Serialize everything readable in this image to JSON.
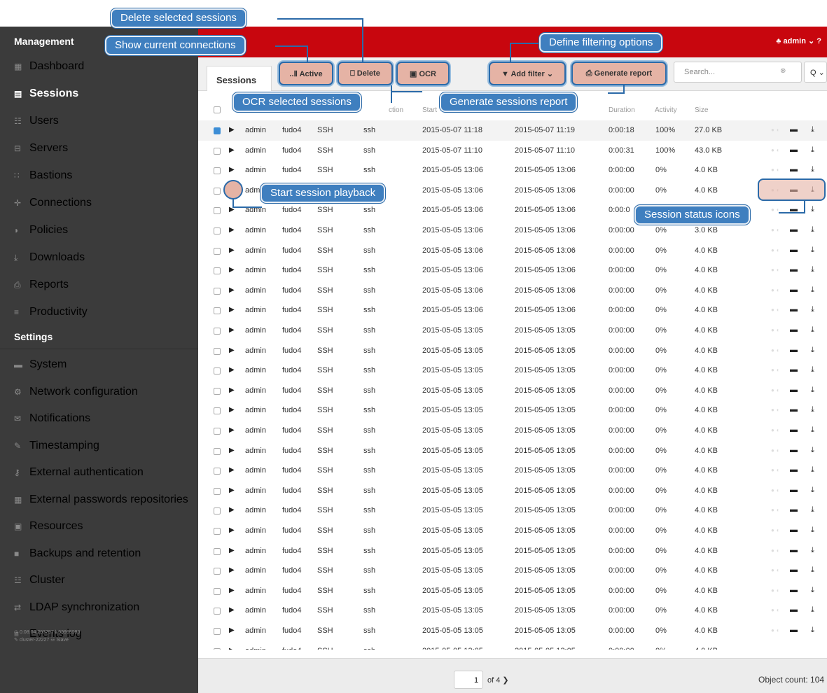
{
  "header": {
    "brand": "Management",
    "user_label": "♣ admin ⌄",
    "help": "?"
  },
  "sidebar": {
    "management_items": [
      {
        "icon": "dashboard-icon",
        "glyph": "▦",
        "label": "Dashboard"
      },
      {
        "icon": "sessions-icon",
        "glyph": "▤",
        "label": "Sessions"
      },
      {
        "icon": "users-icon",
        "glyph": "☷",
        "label": "Users"
      },
      {
        "icon": "servers-icon",
        "glyph": "⊟",
        "label": "Servers"
      },
      {
        "icon": "bastions-icon",
        "glyph": "∷",
        "label": "Bastions"
      },
      {
        "icon": "connections-icon",
        "glyph": "✛",
        "label": "Connections"
      },
      {
        "icon": "policies-icon",
        "glyph": "◗",
        "label": "Policies"
      },
      {
        "icon": "downloads-icon",
        "glyph": "⤓",
        "label": "Downloads"
      },
      {
        "icon": "reports-icon",
        "glyph": "⎙",
        "label": "Reports"
      },
      {
        "icon": "productivity-icon",
        "glyph": "≡",
        "label": "Productivity"
      }
    ],
    "settings_title": "Settings",
    "settings_items": [
      {
        "icon": "system-icon",
        "glyph": "▬",
        "label": "System"
      },
      {
        "icon": "network-icon",
        "glyph": "⚙",
        "label": "Network configuration"
      },
      {
        "icon": "notifications-icon",
        "glyph": "✉",
        "label": "Notifications"
      },
      {
        "icon": "timestamping-icon",
        "glyph": "✎",
        "label": "Timestamping"
      },
      {
        "icon": "external-auth-icon",
        "glyph": "⚷",
        "label": "External authentication"
      },
      {
        "icon": "passwords-repo-icon",
        "glyph": "▦",
        "label": "External passwords repositories"
      },
      {
        "icon": "resources-icon",
        "glyph": "▣",
        "label": "Resources"
      },
      {
        "icon": "backups-icon",
        "glyph": "■",
        "label": "Backups and retention"
      },
      {
        "icon": "cluster-icon",
        "glyph": "☳",
        "label": "Cluster"
      },
      {
        "icon": "ldap-icon",
        "glyph": "⇄",
        "label": "LDAP synchronization"
      },
      {
        "icon": "events-icon",
        "glyph": "≡",
        "label": "Events log"
      }
    ],
    "footer_line1": "◷ 0:08:04.293297 ℹ 99999999",
    "footer_line2": "✎ cluster-22227  ☳ Slave"
  },
  "toolbar": {
    "tab": "Sessions",
    "active": "..Ⅱ Active",
    "delete": "⎕ Delete",
    "ocr": "▣ OCR",
    "add_filter": "▼ Add filter ⌄",
    "generate_report": "⎙ Generate report",
    "search_placeholder": "Search...",
    "search_clear": "⊗",
    "search_btn": "Q ⌄"
  },
  "table": {
    "headers": [
      "Start",
      "End",
      "Duration",
      "Activity",
      "Size"
    ],
    "header_partial": "ction",
    "rows": [
      {
        "sel": true,
        "user": "admin",
        "server": "fudo4",
        "proto": "SSH",
        "conn": "ssh",
        "start": "2015-05-07 11:18",
        "end": "2015-05-07 11:19",
        "dur": "0:00:18",
        "act": "100%",
        "size": "27.0 KB"
      },
      {
        "sel": false,
        "user": "admin",
        "server": "fudo4",
        "proto": "SSH",
        "conn": "ssh",
        "start": "2015-05-07 11:10",
        "end": "2015-05-07 11:10",
        "dur": "0:00:31",
        "act": "100%",
        "size": "43.0 KB"
      },
      {
        "sel": false,
        "user": "admin",
        "server": "fudo4",
        "proto": "SSH",
        "conn": "ssh",
        "start": "2015-05-05 13:06",
        "end": "2015-05-05 13:06",
        "dur": "0:00:00",
        "act": "0%",
        "size": "4.0 KB"
      },
      {
        "sel": false,
        "user": "adm",
        "server": "",
        "proto": "",
        "conn": "",
        "start": "2015-05-05 13:06",
        "end": "2015-05-05 13:06",
        "dur": "0:00:00",
        "act": "0%",
        "size": "4.0 KB"
      },
      {
        "sel": false,
        "user": "admin",
        "server": "fudo4",
        "proto": "SSH",
        "conn": "ssh",
        "start": "2015-05-05 13:06",
        "end": "2015-05-05 13:06",
        "dur": "0:00:0",
        "act": "",
        "size": ""
      },
      {
        "sel": false,
        "user": "admin",
        "server": "fudo4",
        "proto": "SSH",
        "conn": "ssh",
        "start": "2015-05-05 13:06",
        "end": "2015-05-05 13:06",
        "dur": "0:00:00",
        "act": "0%",
        "size": "3.0 KB"
      },
      {
        "sel": false,
        "user": "admin",
        "server": "fudo4",
        "proto": "SSH",
        "conn": "ssh",
        "start": "2015-05-05 13:06",
        "end": "2015-05-05 13:06",
        "dur": "0:00:00",
        "act": "0%",
        "size": "4.0 KB"
      },
      {
        "sel": false,
        "user": "admin",
        "server": "fudo4",
        "proto": "SSH",
        "conn": "ssh",
        "start": "2015-05-05 13:06",
        "end": "2015-05-05 13:06",
        "dur": "0:00:00",
        "act": "0%",
        "size": "4.0 KB"
      },
      {
        "sel": false,
        "user": "admin",
        "server": "fudo4",
        "proto": "SSH",
        "conn": "ssh",
        "start": "2015-05-05 13:06",
        "end": "2015-05-05 13:06",
        "dur": "0:00:00",
        "act": "0%",
        "size": "4.0 KB"
      },
      {
        "sel": false,
        "user": "admin",
        "server": "fudo4",
        "proto": "SSH",
        "conn": "ssh",
        "start": "2015-05-05 13:06",
        "end": "2015-05-05 13:06",
        "dur": "0:00:00",
        "act": "0%",
        "size": "4.0 KB"
      },
      {
        "sel": false,
        "user": "admin",
        "server": "fudo4",
        "proto": "SSH",
        "conn": "ssh",
        "start": "2015-05-05 13:05",
        "end": "2015-05-05 13:05",
        "dur": "0:00:00",
        "act": "0%",
        "size": "4.0 KB"
      },
      {
        "sel": false,
        "user": "admin",
        "server": "fudo4",
        "proto": "SSH",
        "conn": "ssh",
        "start": "2015-05-05 13:05",
        "end": "2015-05-05 13:05",
        "dur": "0:00:00",
        "act": "0%",
        "size": "4.0 KB"
      },
      {
        "sel": false,
        "user": "admin",
        "server": "fudo4",
        "proto": "SSH",
        "conn": "ssh",
        "start": "2015-05-05 13:05",
        "end": "2015-05-05 13:05",
        "dur": "0:00:00",
        "act": "0%",
        "size": "4.0 KB"
      },
      {
        "sel": false,
        "user": "admin",
        "server": "fudo4",
        "proto": "SSH",
        "conn": "ssh",
        "start": "2015-05-05 13:05",
        "end": "2015-05-05 13:05",
        "dur": "0:00:00",
        "act": "0%",
        "size": "4.0 KB"
      },
      {
        "sel": false,
        "user": "admin",
        "server": "fudo4",
        "proto": "SSH",
        "conn": "ssh",
        "start": "2015-05-05 13:05",
        "end": "2015-05-05 13:05",
        "dur": "0:00:00",
        "act": "0%",
        "size": "4.0 KB"
      },
      {
        "sel": false,
        "user": "admin",
        "server": "fudo4",
        "proto": "SSH",
        "conn": "ssh",
        "start": "2015-05-05 13:05",
        "end": "2015-05-05 13:05",
        "dur": "0:00:00",
        "act": "0%",
        "size": "4.0 KB"
      },
      {
        "sel": false,
        "user": "admin",
        "server": "fudo4",
        "proto": "SSH",
        "conn": "ssh",
        "start": "2015-05-05 13:05",
        "end": "2015-05-05 13:05",
        "dur": "0:00:00",
        "act": "0%",
        "size": "4.0 KB"
      },
      {
        "sel": false,
        "user": "admin",
        "server": "fudo4",
        "proto": "SSH",
        "conn": "ssh",
        "start": "2015-05-05 13:05",
        "end": "2015-05-05 13:05",
        "dur": "0:00:00",
        "act": "0%",
        "size": "4.0 KB"
      },
      {
        "sel": false,
        "user": "admin",
        "server": "fudo4",
        "proto": "SSH",
        "conn": "ssh",
        "start": "2015-05-05 13:05",
        "end": "2015-05-05 13:05",
        "dur": "0:00:00",
        "act": "0%",
        "size": "4.0 KB"
      },
      {
        "sel": false,
        "user": "admin",
        "server": "fudo4",
        "proto": "SSH",
        "conn": "ssh",
        "start": "2015-05-05 13:05",
        "end": "2015-05-05 13:05",
        "dur": "0:00:00",
        "act": "0%",
        "size": "4.0 KB"
      },
      {
        "sel": false,
        "user": "admin",
        "server": "fudo4",
        "proto": "SSH",
        "conn": "ssh",
        "start": "2015-05-05 13:05",
        "end": "2015-05-05 13:05",
        "dur": "0:00:00",
        "act": "0%",
        "size": "4.0 KB"
      },
      {
        "sel": false,
        "user": "admin",
        "server": "fudo4",
        "proto": "SSH",
        "conn": "ssh",
        "start": "2015-05-05 13:05",
        "end": "2015-05-05 13:05",
        "dur": "0:00:00",
        "act": "0%",
        "size": "4.0 KB"
      },
      {
        "sel": false,
        "user": "admin",
        "server": "fudo4",
        "proto": "SSH",
        "conn": "ssh",
        "start": "2015-05-05 13:05",
        "end": "2015-05-05 13:05",
        "dur": "0:00:00",
        "act": "0%",
        "size": "4.0 KB"
      },
      {
        "sel": false,
        "user": "admin",
        "server": "fudo4",
        "proto": "SSH",
        "conn": "ssh",
        "start": "2015-05-05 13:05",
        "end": "2015-05-05 13:05",
        "dur": "0:00:00",
        "act": "0%",
        "size": "4.0 KB"
      },
      {
        "sel": false,
        "user": "admin",
        "server": "fudo4",
        "proto": "SSH",
        "conn": "ssh",
        "start": "2015-05-05 13:05",
        "end": "2015-05-05 13:05",
        "dur": "0:00:00",
        "act": "0%",
        "size": "4.0 KB"
      },
      {
        "sel": false,
        "user": "admin",
        "server": "fudo4",
        "proto": "SSH",
        "conn": "ssh",
        "start": "2015-05-05 13:05",
        "end": "2015-05-05 13:05",
        "dur": "0:00:00",
        "act": "0%",
        "size": "4.0 KB"
      }
    ],
    "last_row_partial": {
      "user": "admin",
      "server": "fudo4",
      "proto": "SSH",
      "conn": "ssh",
      "start": "2015-05-05 13:05",
      "end": "2015-05-05 13:05",
      "dur": "0:00:00",
      "act": "0%",
      "size": "4.0 KB"
    }
  },
  "footer": {
    "page": "1",
    "of": "of 4 ❯",
    "object_count": "Object count: 104"
  },
  "callouts": {
    "delete_selected": "Delete selected sessions",
    "show_connections": "Show current connections",
    "define_filter": "Define filtering options",
    "ocr_selected": "OCR selected sessions",
    "generate_report": "Generate sessions report",
    "start_playback": "Start session playback",
    "status_icons": "Session status icons"
  },
  "colors": {
    "accent_red": "#c8060e",
    "sidebar_bg": "#3b3b3b",
    "callout_blue": "#3f7fbf",
    "highlight": "#e5b3a5"
  }
}
